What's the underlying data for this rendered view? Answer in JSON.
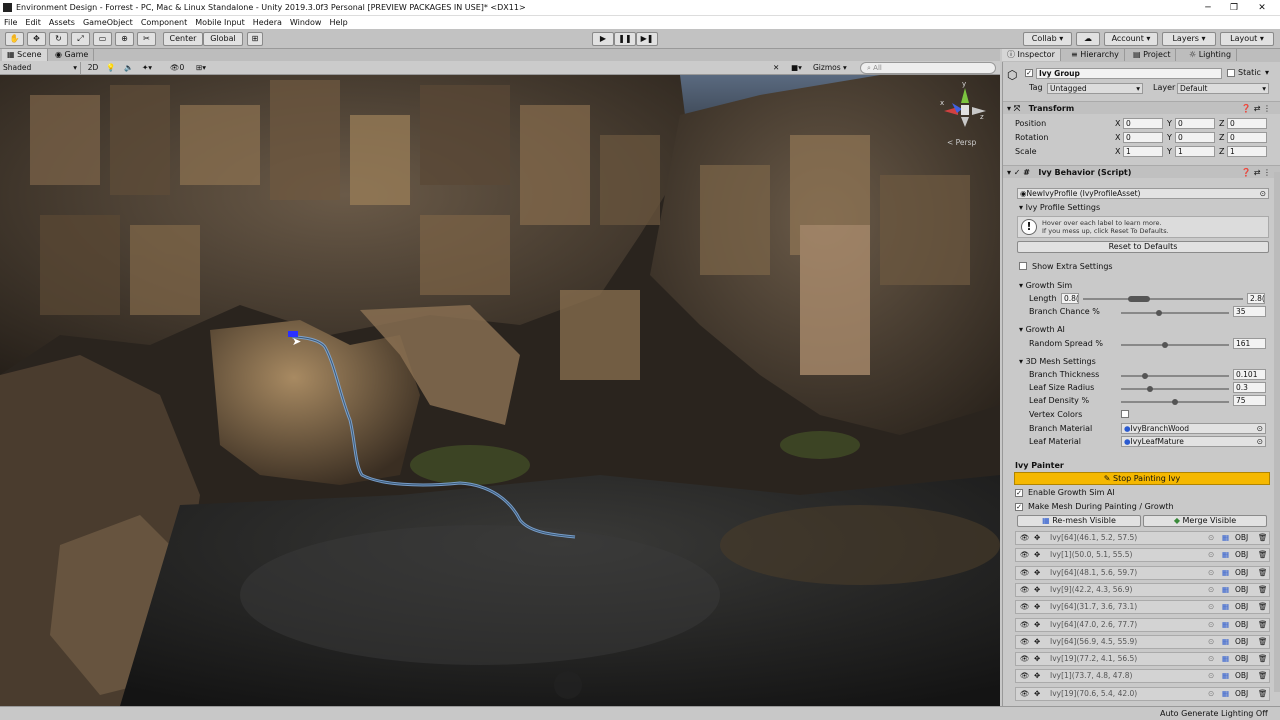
{
  "window": {
    "title": "Environment Design - Forrest - PC, Mac & Linux Standalone - Unity 2019.3.0f3 Personal [PREVIEW PACKAGES IN USE]* <DX11>",
    "minimize": "─",
    "maximize": "❐",
    "close": "✕"
  },
  "menu": [
    "File",
    "Edit",
    "Assets",
    "GameObject",
    "Component",
    "Mobile Input",
    "Hedera",
    "Window",
    "Help"
  ],
  "toolbar": {
    "center": "Center",
    "global": "Global",
    "collab": "Collab ▾",
    "account": "Account",
    "layers": "Layers",
    "layout": "Layout",
    "play": "▶",
    "pause": "❚❚",
    "step": "▶❚",
    "cloud": "☁"
  },
  "scene_tabs": {
    "scene": "Scene",
    "game": "Game"
  },
  "scene_bar": {
    "shading": "Shaded",
    "mode2d": "2D",
    "fx_count": "0",
    "gizmos": "Gizmos",
    "search_placeholder": "All"
  },
  "viewport": {
    "persp_label": "< Persp",
    "axis_y": "y",
    "axis_x": "x",
    "axis_z": "z"
  },
  "inspector_tabs": [
    "Inspector",
    "Hierarchy",
    "Project",
    "Lighting"
  ],
  "object": {
    "name": "Ivy Group",
    "static_label": "Static",
    "tag_label": "Tag",
    "tag_value": "Untagged",
    "layer_label": "Layer",
    "layer_value": "Default"
  },
  "transform": {
    "title": "Transform",
    "rows": [
      {
        "label": "Position",
        "x": "0",
        "y": "0",
        "z": "0"
      },
      {
        "label": "Rotation",
        "x": "0",
        "y": "0",
        "z": "0"
      },
      {
        "label": "Scale",
        "x": "1",
        "y": "1",
        "z": "1"
      }
    ]
  },
  "ivy_behavior": {
    "title": "Ivy Behavior (Script)",
    "profile": "NewIvyProfile (IvyProfileAsset)",
    "profile_settings": "Ivy Profile Settings",
    "help_line1": "Hover over each label to learn more.",
    "help_line2": "If you mess up, click Reset To Defaults.",
    "reset_button": "Reset to Defaults",
    "show_extra": "Show Extra Settings",
    "growth_sim": "Growth Sim",
    "length_label": "Length",
    "length_min": "0.8(",
    "length_max": "2.8(",
    "length_range": [
      0.28,
      0.42
    ],
    "branch_chance_label": "Branch Chance %",
    "branch_chance": "35",
    "branch_chance_level": 0.35,
    "growth_ai": "Growth AI",
    "random_spread_label": "Random Spread %",
    "random_spread": "161",
    "random_spread_level": 0.41,
    "mesh_settings": "3D Mesh Settings",
    "branch_thickness_label": "Branch Thickness",
    "branch_thickness": "0.101",
    "branch_thickness_level": 0.22,
    "leaf_size_label": "Leaf Size Radius",
    "leaf_size": "0.3",
    "leaf_size_level": 0.27,
    "leaf_density_label": "Leaf Density %",
    "leaf_density": "75",
    "leaf_density_level": 0.5,
    "vertex_colors_label": "Vertex Colors",
    "branch_material_label": "Branch Material",
    "branch_material": "IvyBranchWood",
    "leaf_material_label": "Leaf Material",
    "leaf_material": "IvyLeafMature"
  },
  "ivy_painter": {
    "title": "Ivy Painter",
    "stop_button": "Stop Painting Ivy",
    "enable_growth": "Enable Growth Sim AI",
    "make_mesh": "Make Mesh During Painting / Growth",
    "remesh": "Re-mesh Visible",
    "merge": "Merge Visible",
    "obj_label": "OBJ",
    "items": [
      "Ivy[64](46.1, 5.2, 57.5)",
      "Ivy[1](50.0, 5.1, 55.5)",
      "Ivy[64](48.1, 5.6, 59.7)",
      "Ivy[9](42.2, 4.3, 56.9)",
      "Ivy[64](31.7, 3.6, 73.1)",
      "Ivy[64](47.0, 2.6, 77.7)",
      "Ivy[64](56.9, 4.5, 55.9)",
      "Ivy[19](77.2, 4.1, 56.5)",
      "Ivy[1](73.7, 4.8, 47.8)",
      "Ivy[19](70.6, 5.4, 42.0)"
    ]
  },
  "status": {
    "right": "Auto Generate Lighting Off"
  },
  "colors": {
    "accent_yellow": "#f5b800",
    "selection_blue": "#7fa8d8",
    "panel": "#c9c9c9"
  }
}
